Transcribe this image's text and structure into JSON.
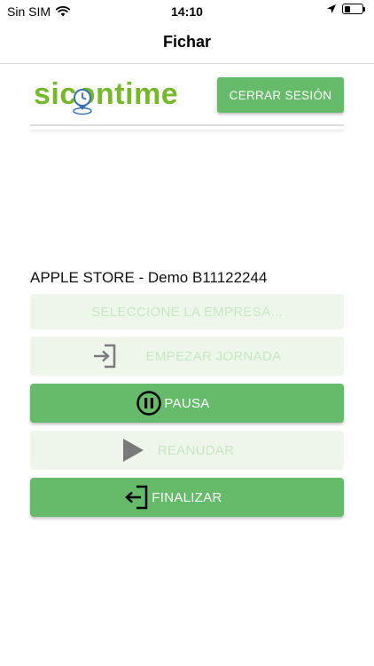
{
  "status_bar": {
    "carrier": "Sin SIM",
    "time": "14:10"
  },
  "nav": {
    "title": "Fichar"
  },
  "logo": {
    "text": "sicontime",
    "color": "#76b82a"
  },
  "header": {
    "logout_label": "CERRAR SESIÓN"
  },
  "company": {
    "label": "APPLE STORE - Demo B11122244"
  },
  "actions": {
    "select_company": "SELECCIONE LA EMPRESA...",
    "start_day": "EMPEZAR JORNADA",
    "pause": "PAUSA",
    "resume": "REANUDAR",
    "finish": "FINALIZAR"
  },
  "colors": {
    "accent": "#66bb6a",
    "disabled_bg": "#eef6ec",
    "disabled_text": "#c8e6c2"
  }
}
